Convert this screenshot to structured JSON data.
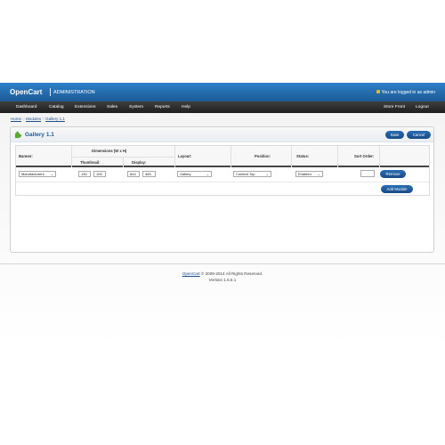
{
  "header": {
    "logo": "OpenCart",
    "subtitle": "ADMINISTRATION",
    "logged_in": "You are logged in as admin"
  },
  "menu": {
    "left": [
      "Dashboard",
      "Catalog",
      "Extensions",
      "Sales",
      "System",
      "Reports",
      "Help"
    ],
    "right": [
      "Store Front",
      "Logout"
    ]
  },
  "breadcrumb": {
    "items": [
      "Home",
      "Modules",
      "Gallery 1.1"
    ],
    "separator": "::"
  },
  "page": {
    "title": "Gallery 1.1",
    "save_label": "Save",
    "cancel_label": "Cancel"
  },
  "table": {
    "headers": {
      "banner": "Banner:",
      "dimensions": "Dimensions (W x H)",
      "thumbnail": "Thumbnail:",
      "display": "Display:",
      "layout": "Layout:",
      "position": "Position:",
      "status": "Status:",
      "sort_order": "Sort Order:"
    },
    "row": {
      "banner": "Manufacturers",
      "thumb_w": "130",
      "thumb_h": "100",
      "display_w": "644",
      "display_h": "483",
      "layout": "Gallery",
      "position": "Content Top",
      "status": "Enabled",
      "sort_order": ""
    },
    "remove_label": "Remove",
    "add_module_label": "Add Module"
  },
  "footer": {
    "brand": "OpenCart",
    "copyright": "© 2009-2014 All Rights Reserved.",
    "version": "Version 1.5.6.1"
  },
  "colors": {
    "header_blue": "#1c5a95",
    "button_blue": "#1f5ca0",
    "menu_dark": "#2b2b2b"
  }
}
